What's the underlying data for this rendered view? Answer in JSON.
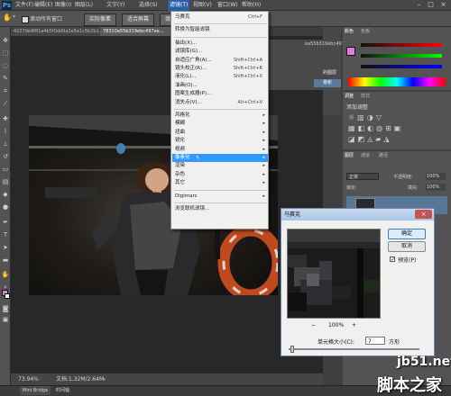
{
  "app": {
    "logo": "Ps"
  },
  "menubar": {
    "items": [
      "文件(F)",
      "编辑(E)",
      "图像(I)",
      "图层(L)",
      "文字(Y)",
      "选择(S)",
      "滤镜(T)",
      "视图(V)",
      "窗口(W)",
      "帮助(H)"
    ],
    "active_index": 6
  },
  "window_controls": {
    "minimize": "–",
    "maximize": "□",
    "close": "×"
  },
  "options": {
    "scroll_all_label": "滚动所有窗口",
    "actual_pixels": "实际像素",
    "fit_screen": "适合屏幕",
    "fill_screen": "填充屏幕"
  },
  "tabs": [
    "42279e9f81a4b5f0dd9a2e5e1c5b2b1.jpg",
    "78310a55b319ebc497ee..."
  ],
  "filter_menu": {
    "items": [
      {
        "label": "马赛克",
        "shortcut": "Ctrl+F"
      },
      {
        "sep": true
      },
      {
        "label": "转换为智能滤镜"
      },
      {
        "sep": true
      },
      {
        "label": "抽出(X)..."
      },
      {
        "label": "滤镜库(G)..."
      },
      {
        "label": "自适应广角(A)...",
        "shortcut": "Shift+Ctrl+A"
      },
      {
        "label": "镜头校正(R)...",
        "shortcut": "Shift+Ctrl+R"
      },
      {
        "label": "液化(L)...",
        "shortcut": "Shift+Ctrl+X"
      },
      {
        "label": "油画(O)..."
      },
      {
        "label": "图案生成器(P)..."
      },
      {
        "label": "消失点(V)...",
        "shortcut": "Alt+Ctrl+V"
      },
      {
        "sep": true
      },
      {
        "label": "风格化",
        "sub": true
      },
      {
        "label": "模糊",
        "sub": true
      },
      {
        "label": "扭曲",
        "sub": true
      },
      {
        "label": "锐化",
        "sub": true
      },
      {
        "label": "视频",
        "sub": true
      },
      {
        "label": "像素化",
        "sub": true,
        "highlighted": true
      },
      {
        "label": "渲染",
        "sub": true
      },
      {
        "label": "杂色",
        "sub": true
      },
      {
        "label": "其它",
        "sub": true
      },
      {
        "sep": true
      },
      {
        "label": "Digimarc",
        "sub": true
      },
      {
        "sep": true
      },
      {
        "label": "浏览联机滤镜..."
      }
    ]
  },
  "panels": {
    "color_tabs": [
      "颜色",
      "色板"
    ],
    "adjust_tabs": [
      "调整",
      "样式"
    ],
    "adjust_title": "添加调整",
    "layers_tabs": [
      "图层",
      "通道",
      "路径"
    ],
    "blend_mode": "正常",
    "opacity_label": "不透明度:",
    "opacity_value": "100%",
    "lock_label": "锁定:",
    "fill_label": "填充:",
    "fill_value": "100%",
    "history_item_1": "ea55b319ebc497ee",
    "history_item_2": "的图层",
    "history_item_3": "景新"
  },
  "status": {
    "zoom": "73.94%",
    "doc": "文档:1.32M/2.64M"
  },
  "bottom_tabs": [
    "Mini Bridge",
    "时间轴"
  ],
  "dialog": {
    "title": "马赛克",
    "ok": "确定",
    "cancel": "取消",
    "preview_label": "预览(P)",
    "preview_checked": true,
    "zoom": "100%",
    "zoom_out": "−",
    "zoom_in": "+",
    "cell_label": "单元格大小(C):",
    "cell_value": "7",
    "cell_unit": "方形",
    "close": "×"
  },
  "watermark": {
    "site": "jb51.net",
    "name": "脚本之家"
  }
}
